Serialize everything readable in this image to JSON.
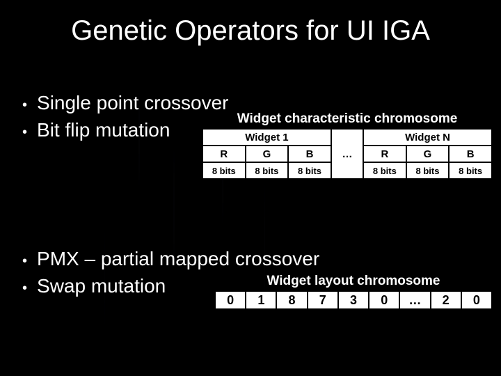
{
  "title": "Genetic Operators for UI IGA",
  "bullets_top": [
    "Single point crossover",
    "Bit flip mutation"
  ],
  "bullets_bottom": [
    "PMX – partial mapped crossover",
    "Swap mutation"
  ],
  "diagram_char": {
    "title": "Widget characteristic chromosome",
    "group_left": "Widget 1",
    "group_right": "Widget N",
    "row_labels": {
      "r": "R",
      "g": "G",
      "b": "B",
      "ell": "…"
    },
    "row_bits": {
      "r": "8 bits",
      "g": "8 bits",
      "b": "8 bits"
    }
  },
  "diagram_layout": {
    "title": "Widget layout chromosome",
    "cells": [
      "0",
      "1",
      "8",
      "7",
      "3",
      "0",
      "…",
      "2",
      "0"
    ]
  }
}
